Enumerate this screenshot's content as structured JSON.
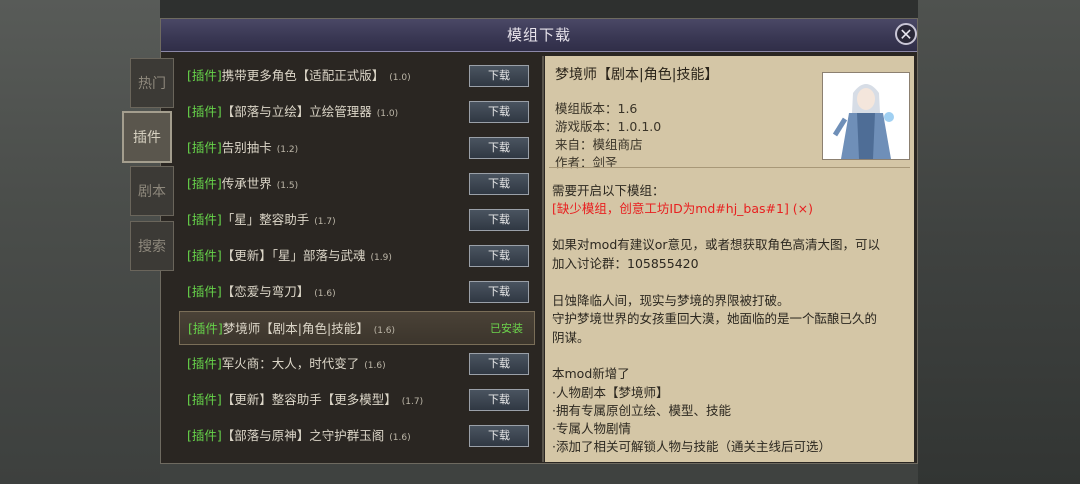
{
  "dialog": {
    "title": "模组下载",
    "close_glyph": "✕"
  },
  "tabs": [
    {
      "label": "热门",
      "active": false
    },
    {
      "label": "插件",
      "active": true
    },
    {
      "label": "剧本",
      "active": false
    },
    {
      "label": "搜索",
      "active": false
    }
  ],
  "mods": [
    {
      "tag": "[插件]",
      "name": "携带更多角色【适配正式版】",
      "version": "(1.0)",
      "action": "下载"
    },
    {
      "tag": "[插件]",
      "name": "【部落与立绘】立绘管理器",
      "version": "(1.0)",
      "action": "下载"
    },
    {
      "tag": "[插件]",
      "name": "告别抽卡",
      "version": "(1.2)",
      "action": "下载"
    },
    {
      "tag": "[插件]",
      "name": "传承世界",
      "version": "(1.5)",
      "action": "下载"
    },
    {
      "tag": "[插件]",
      "name": "「星」整容助手",
      "version": "(1.7)",
      "action": "下载"
    },
    {
      "tag": "[插件]",
      "name": "【更新】「星」部落与武魂",
      "version": "(1.9)",
      "action": "下载"
    },
    {
      "tag": "[插件]",
      "name": "【恋爱与弯刀】",
      "version": "(1.6)",
      "action": "下载"
    },
    {
      "tag": "[插件]",
      "name": "梦境师【剧本|角色|技能】",
      "version": "(1.6)",
      "action": "已安装",
      "selected": true
    },
    {
      "tag": "[插件]",
      "name": "军火商：大人，时代变了",
      "version": "(1.6)",
      "action": "下载"
    },
    {
      "tag": "[插件]",
      "name": "【更新】整容助手【更多模型】",
      "version": "(1.7)",
      "action": "下载"
    },
    {
      "tag": "[插件]",
      "name": "【部落与原神】之守护群玉阁",
      "version": "(1.6)",
      "action": "下载"
    }
  ],
  "detail": {
    "title": "梦境师【剧本|角色|技能】",
    "meta": [
      "模组版本：1.6",
      "游戏版本：1.0.1.0",
      "来自：模组商店",
      "作者：剑圣"
    ],
    "body": [
      {
        "text": "需要开启以下模组：",
        "red": false
      },
      {
        "text": "[缺少模组，创意工坊ID为md#hj_bas#1] (×)",
        "red": true
      },
      {
        "text": "",
        "red": false
      },
      {
        "text": "如果对mod有建议or意见，或者想获取角色高清大图，可以",
        "red": false
      },
      {
        "text": "加入讨论群：105855420",
        "red": false
      },
      {
        "text": "",
        "red": false
      },
      {
        "text": "日蚀降临人间，现实与梦境的界限被打破。",
        "red": false
      },
      {
        "text": "守护梦境世界的女孩重回大漠，她面临的是一个酝酿已久的",
        "red": false
      },
      {
        "text": "阴谋。",
        "red": false
      },
      {
        "text": "",
        "red": false
      },
      {
        "text": "本mod新增了",
        "red": false
      },
      {
        "text": "·人物剧本【梦境师】",
        "red": false
      },
      {
        "text": "·拥有专属原创立绘、模型、技能",
        "red": false
      },
      {
        "text": "·专属人物剧情",
        "red": false
      },
      {
        "text": "·添加了相关可解锁人物与技能（通关主线后可选）",
        "red": false
      }
    ]
  },
  "colors": {
    "tag_green": "#66d34a",
    "installed_green": "#6cd44c",
    "warning_red": "#e82020",
    "title_bar": "#3a3854"
  },
  "icons": {
    "close": "close-icon",
    "portrait": "character-portrait"
  }
}
